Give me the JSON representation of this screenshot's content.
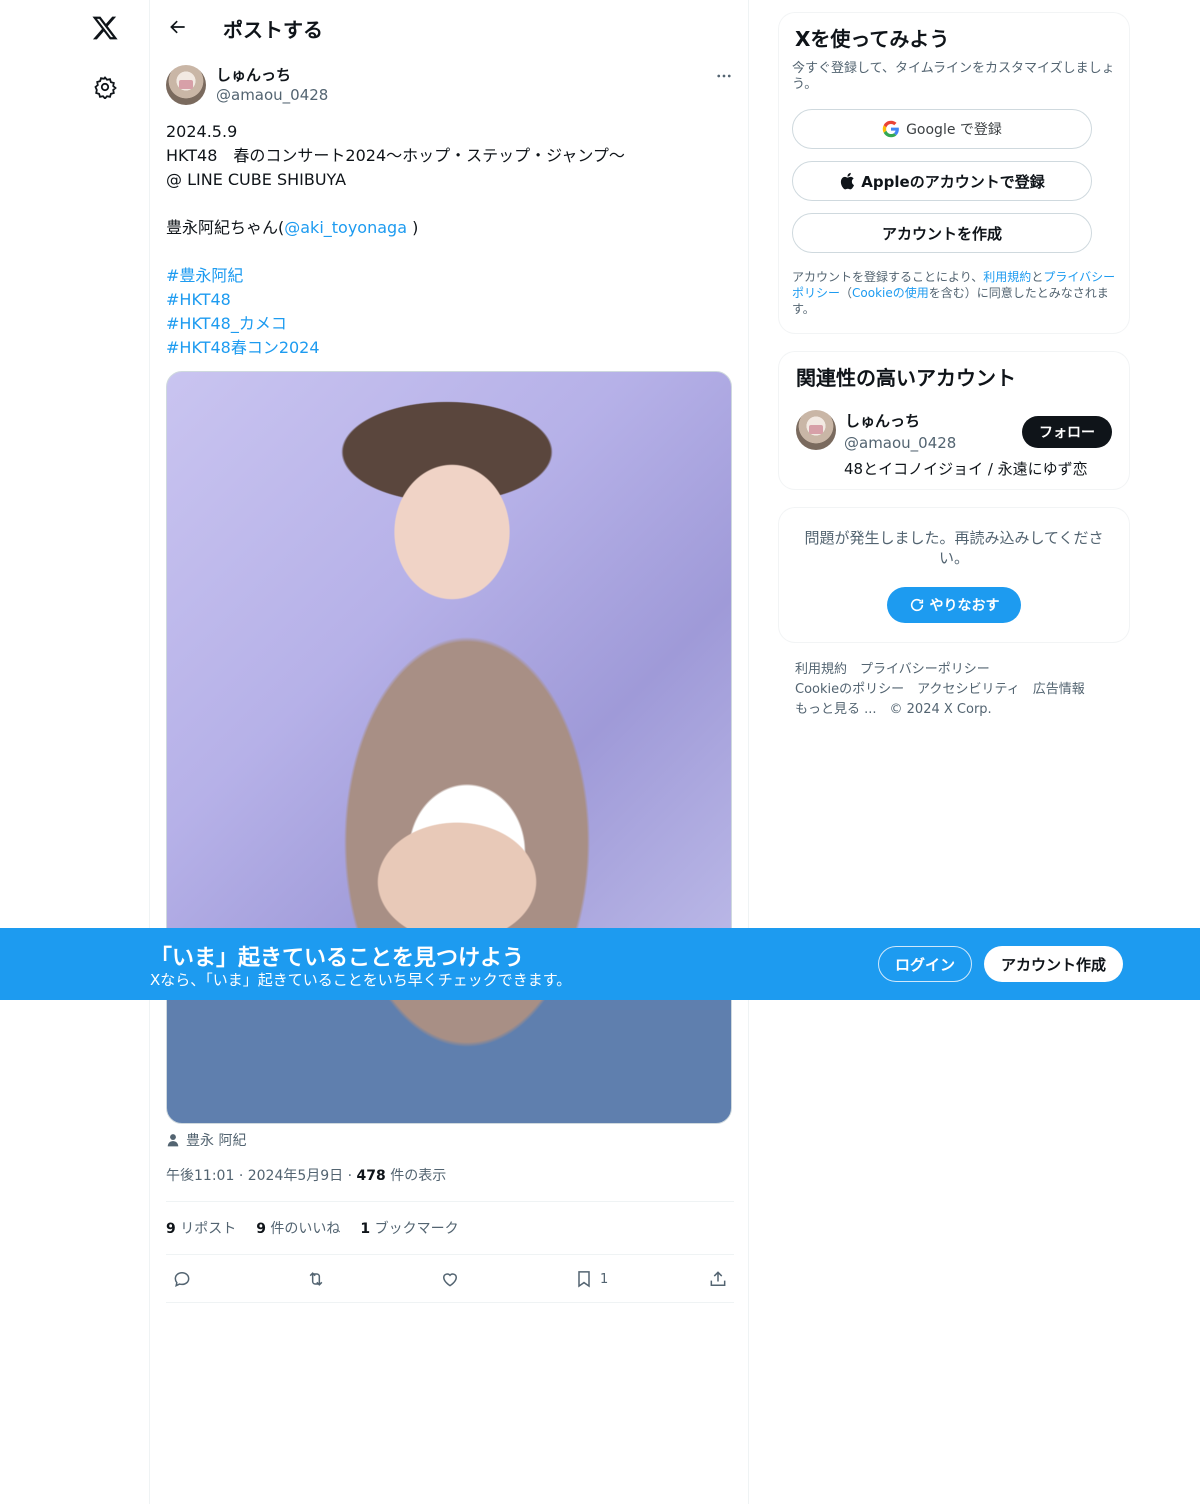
{
  "nav": {
    "logo_icon": "x-logo-icon",
    "settings_icon": "gear-icon"
  },
  "header": {
    "title": "ポストする",
    "back_icon": "back-arrow-icon"
  },
  "post": {
    "author_name": "しゅんっち",
    "author_handle": "@amaou_0428",
    "text_lines": [
      "2024.5.9",
      "HKT48　春のコンサート2024〜ホップ・ステップ・ジャンプ〜",
      "@ LINE CUBE SHIBUYA"
    ],
    "mention_prefix": "豊永阿紀ちゃん(",
    "mention": "@aki_toyonaga",
    "mention_suffix": " )",
    "hashtags": [
      "#豊永阿紀",
      "#HKT48",
      "#HKT48_カメコ",
      "#HKT48春コン2024"
    ],
    "media_tag": "豊永 阿紀",
    "time": "午後11:01",
    "date": "2024年5月9日",
    "separator": "·",
    "views_count": "478",
    "views_label": "件の表示",
    "reposts_count": "9",
    "reposts_label": "リポスト",
    "likes_count": "9",
    "likes_label": "件のいいね",
    "bookmarks_count": "1",
    "bookmarks_label": "ブックマーク",
    "bookmark_action_count": "1"
  },
  "signup_card": {
    "title": "Xを使ってみよう",
    "subtitle": "今すぐ登録して、タイムラインをカスタマイズしましょう。",
    "google_label": "Google で登録",
    "apple_label": "Appleのアカウントで登録",
    "create_label": "アカウントを作成",
    "legal_prefix": "アカウントを登録することにより、",
    "legal_terms": "利用規約",
    "legal_and": "と",
    "legal_privacy": "プライバシーポリシー",
    "legal_mid": "（",
    "legal_cookie": "Cookieの使用",
    "legal_suffix": "を含む）に同意したとみなされます。"
  },
  "related": {
    "title": "関連性の高いアカウント",
    "name": "しゅんっち",
    "handle": "@amaou_0428",
    "bio": "48とイコノイジョイ / 永遠にゆず恋",
    "follow_label": "フォロー"
  },
  "error_card": {
    "message": "問題が発生しました。再読み込みしてください。",
    "retry_label": "やりなおす"
  },
  "footer": {
    "links_row1": [
      "利用規約",
      "プライバシーポリシー"
    ],
    "links_row2": [
      "Cookieのポリシー",
      "アクセシビリティ",
      "広告情報"
    ],
    "more": "もっと見る ...",
    "copyright": "© 2024 X Corp."
  },
  "banner": {
    "title": "「いま」起きていることを見つけよう",
    "subtitle": "Xなら、「いま」起きていることをいち早くチェックできます。",
    "login_label": "ログイン",
    "signup_label": "アカウント作成"
  },
  "colors": {
    "accent": "#1d9bf0",
    "text": "#0f1419",
    "secondary": "#536471",
    "border": "#eff3f4"
  }
}
